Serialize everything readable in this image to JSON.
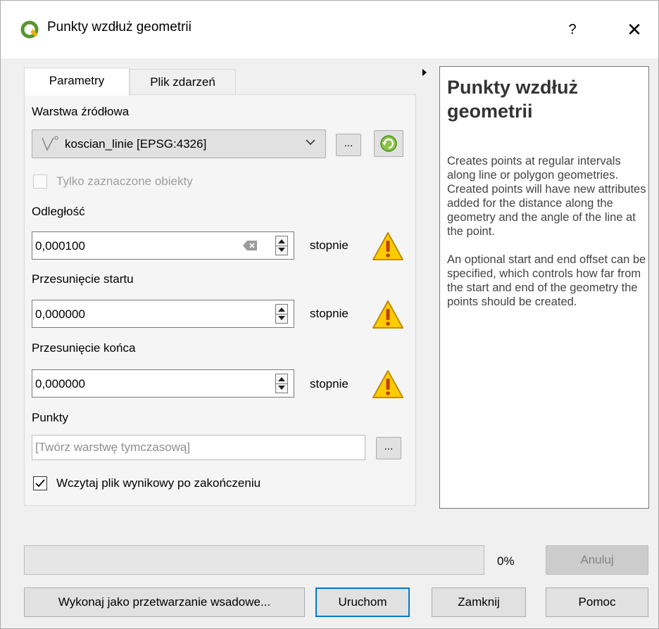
{
  "window": {
    "title": "Punkty wzdłuż geometrii",
    "help_button": "?",
    "close_button": "✕"
  },
  "tabs": [
    {
      "label": "Parametry",
      "active": true
    },
    {
      "label": "Plik zdarzeń",
      "active": false
    }
  ],
  "params": {
    "source_layer": {
      "label": "Warstwa źródłowa",
      "value": "koscian_linie [EPSG:4326]",
      "browse_button": "...",
      "icon": "line-layer-icon"
    },
    "selected_only": {
      "label": "Tylko zaznaczone obiekty",
      "checked": false,
      "enabled": false
    },
    "distance": {
      "label": "Odległość",
      "value": "0,000100",
      "unit": "stopnie"
    },
    "start_offset": {
      "label": "Przesunięcie startu",
      "value": "0,000000",
      "unit": "stopnie"
    },
    "end_offset": {
      "label": "Przesunięcie końca",
      "value": "0,000000",
      "unit": "stopnie"
    },
    "output": {
      "label": "Punkty",
      "placeholder": "[Twórz warstwę tymczasową]",
      "browse_button": "..."
    },
    "load_result": {
      "label": "Wczytaj plik wynikowy po zakończeniu",
      "checked": true
    }
  },
  "help": {
    "title": "Punkty wzdłuż geometrii",
    "paragraphs": [
      "Creates points at regular intervals along line or polygon geometries. Created points will have new attributes added for the distance along the geometry and the angle of the line at the point.",
      "An optional start and end offset can be specified, which controls how far from the start and end of the geometry the points should be created."
    ]
  },
  "progress": {
    "value": 0,
    "text": "0%",
    "cancel_label": "Anuluj"
  },
  "buttons": {
    "batch": "Wykonaj jako przetwarzanie wsadowe...",
    "run": "Uruchom",
    "close": "Zamknij",
    "help": "Pomoc"
  },
  "colors": {
    "qgis_green": "#589632",
    "warning_yellow": "#ffcc00",
    "focus_blue": "#0078d7"
  }
}
